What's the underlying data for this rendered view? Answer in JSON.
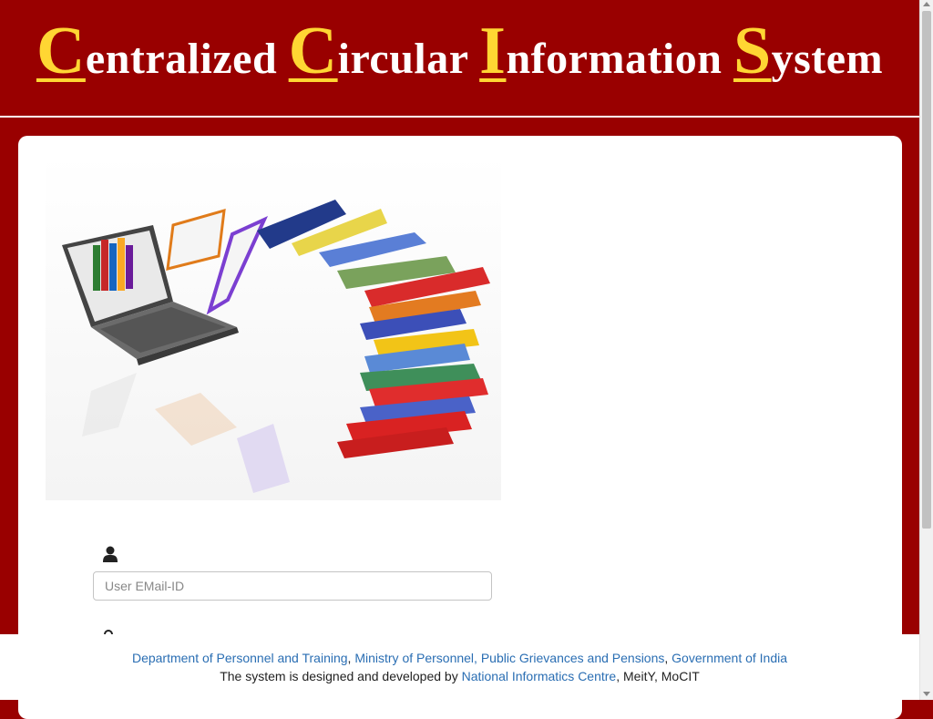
{
  "header": {
    "title_words": [
      {
        "cap": "C",
        "rest": "entralized "
      },
      {
        "cap": "C",
        "rest": "ircular "
      },
      {
        "cap": "I",
        "rest": "nformation "
      },
      {
        "cap": "S",
        "rest": "ystem"
      }
    ]
  },
  "login": {
    "user_icon": "user-icon",
    "email_placeholder": "User EMail-ID",
    "lock_icon": "lock-icon"
  },
  "footer": {
    "line1": {
      "dopt": "Department of Personnel and Training",
      "sep1": ", ",
      "ministry": "Ministry of Personnel, Public Grievances and Pensions",
      "sep2": ", ",
      "goi": "Government of India"
    },
    "line2": {
      "prefix": "The system is designed and developed by ",
      "nic": "National Informatics Centre",
      "suffix": ", MeitY, MoCIT"
    }
  },
  "colors": {
    "header_bg": "#990000",
    "title_caps": "#ffd633",
    "link": "#2a6eb3"
  }
}
